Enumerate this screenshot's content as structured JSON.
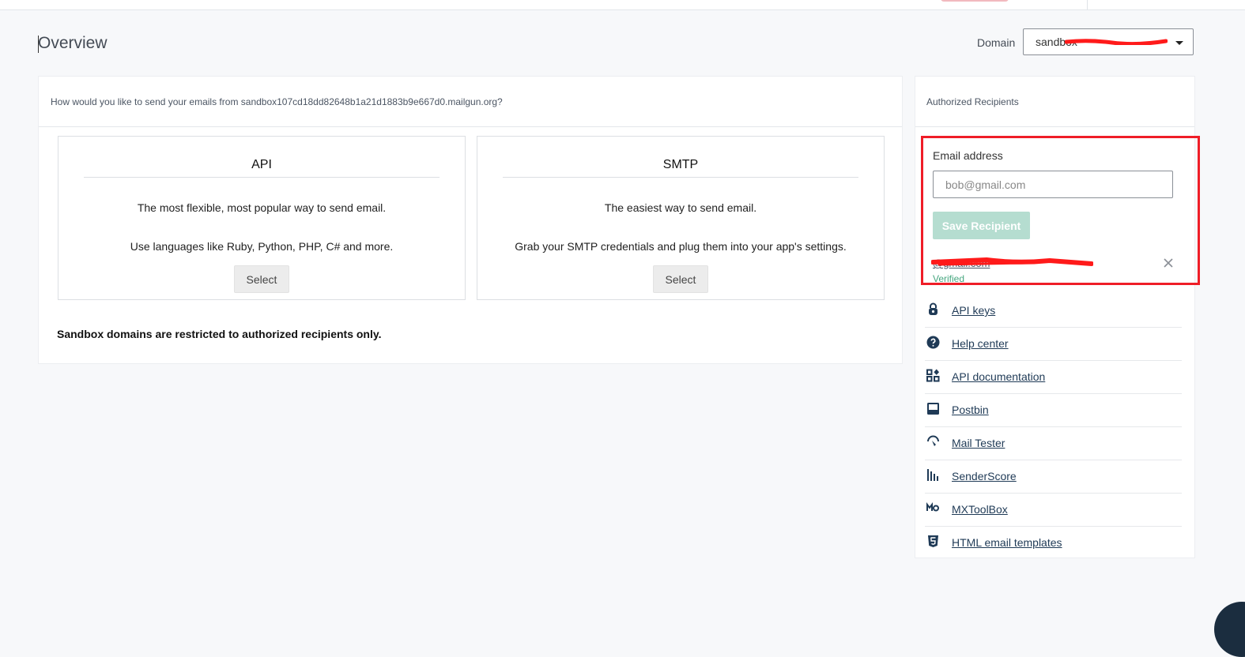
{
  "header": {
    "title": "Overview",
    "domain_label": "Domain",
    "domain_value": "sandbox"
  },
  "main": {
    "question": "How would you like to send your emails from sandbox107cd18dd82648b1a21d1883b9e667d0.mailgun.org?",
    "options": [
      {
        "title": "API",
        "line1": "The most flexible, most popular way to send email.",
        "line2": "Use languages like Ruby, Python, PHP, C# and more.",
        "button": "Select"
      },
      {
        "title": "SMTP",
        "line1": "The easiest way to send email.",
        "line2": "Grab your SMTP credentials and plug them into your app's settings.",
        "button": "Select"
      }
    ],
    "restriction": "Sandbox domains are restricted to authorized recipients only."
  },
  "sidebar": {
    "heading": "Authorized Recipients",
    "email_label": "Email address",
    "email_placeholder": "bob@gmail.com",
    "save_button": "Save Recipient",
    "recipient": {
      "email": "@gmail.com",
      "status": "Verified"
    },
    "links": [
      {
        "label": "API keys",
        "icon": "lock-icon"
      },
      {
        "label": "Help center",
        "icon": "question-circle-icon"
      },
      {
        "label": "API documentation",
        "icon": "widgets-icon"
      },
      {
        "label": "Postbin",
        "icon": "inbox-icon"
      },
      {
        "label": "Mail Tester",
        "icon": "gauge-icon"
      },
      {
        "label": "SenderScore",
        "icon": "bar-chart-icon"
      },
      {
        "label": "MXToolBox",
        "icon": "mx-icon"
      },
      {
        "label": "HTML email templates",
        "icon": "html5-icon"
      }
    ]
  },
  "colors": {
    "accent_link": "#1f3a56",
    "save_button_disabled": "#b5ddd0",
    "verified": "#46a67f",
    "highlight": "#ef1d27"
  }
}
